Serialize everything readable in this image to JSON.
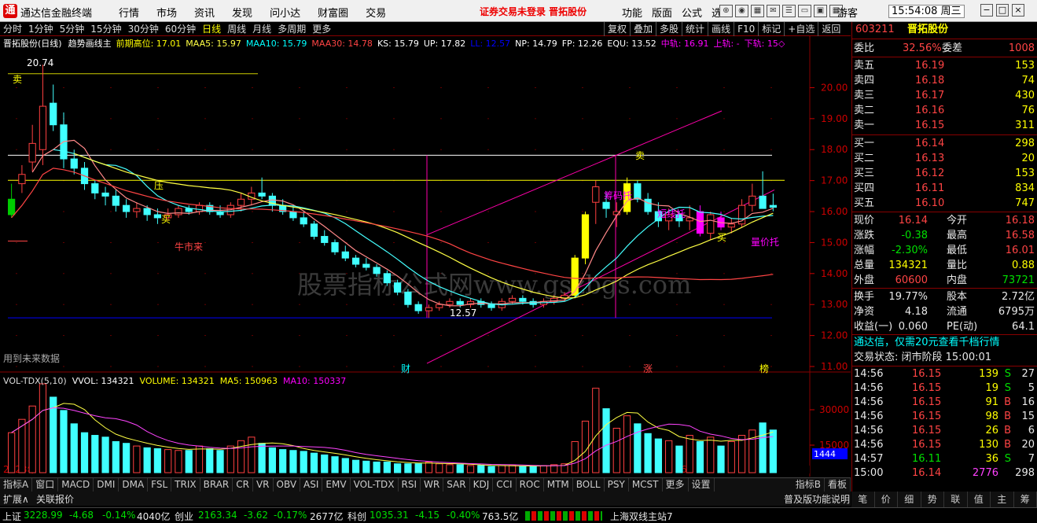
{
  "titlebar": {
    "logo_char": "通",
    "app_name": "通达信金融终端",
    "menus": [
      "行情",
      "市场",
      "资讯",
      "发现",
      "问小达",
      "财富圈",
      "交易"
    ],
    "warning": "证券交易未登录  晋拓股份",
    "right_menus": [
      "功能",
      "版面",
      "公式",
      "选项"
    ],
    "guest": "游客",
    "clock": "15:54:08 周三",
    "win_btns": [
      "−",
      "□",
      "×"
    ]
  },
  "periodbar": {
    "items": [
      "分时",
      "1分钟",
      "5分钟",
      "15分钟",
      "30分钟",
      "60分钟",
      "日线",
      "周线",
      "月线",
      "多周期",
      "更多"
    ],
    "active": "日线"
  },
  "toolbar2": [
    "复权",
    "叠加",
    "多股",
    "统计",
    "画线",
    "F10",
    "标记",
    "+自选",
    "返回"
  ],
  "infoline": {
    "name": "晋拓股份(日线)",
    "indicator": "趋势画线主",
    "items": [
      [
        "前期高位: 17.01",
        "#ff0"
      ],
      [
        "MAA5: 15.97",
        "#ff4"
      ],
      [
        "MAA10: 15.79",
        "#0ff"
      ],
      [
        "MAA30: 14.78",
        "#f44"
      ],
      [
        "KS: 15.79",
        "#fff"
      ],
      [
        "UP: 17.82",
        "#fff"
      ],
      [
        "LL: 12.57",
        "#00f"
      ],
      [
        "NP: 14.79",
        "#fff"
      ],
      [
        "FP: 12.26",
        "#fff"
      ],
      [
        "EQU: 13.52",
        "#fff"
      ],
      [
        "中轨: 16.91",
        "#f0f"
      ],
      [
        "上轨: -",
        "#f0f"
      ],
      [
        "下轨: 15◇",
        "#f0f"
      ]
    ]
  },
  "price_axis": [
    "20.00",
    "19.00",
    "18.00",
    "17.00",
    "16.00",
    "15.00",
    "14.00",
    "13.00",
    "12.00",
    "11.00"
  ],
  "vol_axis": [
    "30000",
    "15000"
  ],
  "chart_labels": {
    "high": "20.74",
    "low": "12.57",
    "sell": "卖",
    "buy": "买",
    "press": "压",
    "bull": "牛市来",
    "future": "用到未来数据",
    "cai": "财",
    "zhang": "涨",
    "bang": "榜",
    "short": "短线托",
    "chip": "筹码托",
    "volprice": "量价托",
    "year": "2023年",
    "m5": "5",
    "m6": "6",
    "watermark": "股票指标公式网www.gszbgs.com",
    "vol_last": "1444"
  },
  "volinfo": {
    "items": [
      [
        "VOL-TDX(5,10)",
        "#ddd"
      ],
      [
        "VVOL: 134321",
        "#fff"
      ],
      [
        "VOLUME: 134321",
        "#ff0"
      ],
      [
        "MA5: 150963",
        "#ff0"
      ],
      [
        "MA10: 150337",
        "#f0f"
      ]
    ]
  },
  "bottombar": [
    "指标A",
    "窗口",
    "MACD",
    "DMI",
    "DMA",
    "FSL",
    "TRIX",
    "BRAR",
    "CR",
    "VR",
    "OBV",
    "ASI",
    "EMV",
    "VOL-TDX",
    "RSI",
    "WR",
    "SAR",
    "KDJ",
    "CCI",
    "ROC",
    "MTM",
    "BOLL",
    "PSY",
    "MCST",
    "更多",
    "设置"
  ],
  "bottombar_right": [
    "指标B",
    "看板"
  ],
  "bottombar2": [
    "扩展∧",
    "关联报价"
  ],
  "bottombar2_right": "普及版功能说明",
  "rp": {
    "code": "603211",
    "name": "晋拓股份",
    "weibi": "委比",
    "weibi_v": "32.56%",
    "weicha": "委差",
    "weicha_v": "1008",
    "asks": [
      [
        "卖五",
        "16.19",
        "153"
      ],
      [
        "卖四",
        "16.18",
        "74"
      ],
      [
        "卖三",
        "16.17",
        "430"
      ],
      [
        "卖二",
        "16.16",
        "76"
      ],
      [
        "卖一",
        "16.15",
        "311"
      ]
    ],
    "bids": [
      [
        "买一",
        "16.14",
        "298"
      ],
      [
        "买二",
        "16.13",
        "20"
      ],
      [
        "买三",
        "16.12",
        "153"
      ],
      [
        "买四",
        "16.11",
        "834"
      ],
      [
        "买五",
        "16.10",
        "747"
      ]
    ],
    "stats": [
      [
        "现价",
        "16.14",
        "今开",
        "16.18"
      ],
      [
        "涨跌",
        "-0.38",
        "最高",
        "16.58"
      ],
      [
        "涨幅",
        "-2.30%",
        "最低",
        "16.01"
      ],
      [
        "总量",
        "134321",
        "量比",
        "0.88"
      ],
      [
        "外盘",
        "60600",
        "内盘",
        "73721"
      ]
    ],
    "stats2": [
      [
        "换手",
        "19.77%",
        "股本",
        "2.72亿"
      ],
      [
        "净资",
        "4.18",
        "流通",
        "6795万"
      ],
      [
        "收益(一)",
        "0.060",
        "PE(动)",
        "64.1"
      ]
    ],
    "promo": "通达信，仅需20元查看千档行情",
    "trade_state": "交易状态: 闭市阶段 15:00:01",
    "ticks": [
      [
        "14:56",
        "16.15",
        "139",
        "S",
        "27"
      ],
      [
        "14:56",
        "16.15",
        "19",
        "S",
        "5"
      ],
      [
        "14:56",
        "16.15",
        "91",
        "B",
        "16"
      ],
      [
        "14:56",
        "16.15",
        "98",
        "B",
        "15"
      ],
      [
        "14:56",
        "16.15",
        "26",
        "B",
        "6"
      ],
      [
        "14:56",
        "16.15",
        "130",
        "B",
        "20"
      ],
      [
        "14:57",
        "16.11",
        "36",
        "S",
        "7"
      ],
      [
        "15:00",
        "16.14",
        "2776",
        "",
        "298"
      ]
    ],
    "tabs": [
      "笔",
      "价",
      "细",
      "势",
      "联",
      "值",
      "主",
      "筹"
    ]
  },
  "right_side_label": "日线",
  "statusbar": {
    "sh": "上证",
    "sh_v": "3228.99",
    "sh_c": "-4.68",
    "sh_p": "-0.14%",
    "sh_a": "4040亿",
    "cy": "创业",
    "cy_v": "2163.34",
    "cy_c": "-3.62",
    "cy_p": "-0.17%",
    "cy_a": "2677亿",
    "kc": "科创",
    "kc_v": "1035.31",
    "kc_c": "-4.15",
    "kc_p": "-0.40%",
    "kc_a": "763.5亿",
    "server": "上海双线主站7"
  },
  "chart_data": {
    "type": "candlestick",
    "ylim": [
      11,
      20.9
    ],
    "candles": [
      [
        15.9,
        16.9,
        15.8,
        16.4
      ],
      [
        16.9,
        17.5,
        16.6,
        17.2
      ],
      [
        17.6,
        18.8,
        17.3,
        18.2
      ],
      [
        18.0,
        20.74,
        17.5,
        19.4
      ],
      [
        19.5,
        20.1,
        18.6,
        18.8
      ],
      [
        18.8,
        19.2,
        17.4,
        17.7
      ],
      [
        17.7,
        18.0,
        17.2,
        17.4
      ],
      [
        17.4,
        17.6,
        16.7,
        16.9
      ],
      [
        16.9,
        17.0,
        16.4,
        16.6
      ],
      [
        16.6,
        16.8,
        16.2,
        16.5
      ],
      [
        16.5,
        16.7,
        16.0,
        16.2
      ],
      [
        16.2,
        16.4,
        15.8,
        16.0
      ],
      [
        16.0,
        16.3,
        15.8,
        16.1
      ],
      [
        16.1,
        16.2,
        15.7,
        15.9
      ],
      [
        15.9,
        16.1,
        15.6,
        15.8
      ],
      [
        15.8,
        16.1,
        15.7,
        15.9
      ],
      [
        15.9,
        16.2,
        15.8,
        16.1
      ],
      [
        16.1,
        16.2,
        15.9,
        16.0
      ],
      [
        16.0,
        16.3,
        15.9,
        16.2
      ],
      [
        16.2,
        16.3,
        15.9,
        16.0
      ],
      [
        16.0,
        16.2,
        15.8,
        15.9
      ],
      [
        15.9,
        16.3,
        15.8,
        16.2
      ],
      [
        16.2,
        16.6,
        16.0,
        16.4
      ],
      [
        16.4,
        16.8,
        16.2,
        16.6
      ],
      [
        16.6,
        17.1,
        16.4,
        16.5
      ],
      [
        16.5,
        16.6,
        16.0,
        16.2
      ],
      [
        16.2,
        16.4,
        15.9,
        16.0
      ],
      [
        16.0,
        16.2,
        15.7,
        15.8
      ],
      [
        15.8,
        16.0,
        15.5,
        15.6
      ],
      [
        15.6,
        15.7,
        15.1,
        15.2
      ],
      [
        15.2,
        15.4,
        14.9,
        15.0
      ],
      [
        15.0,
        15.1,
        14.6,
        14.7
      ],
      [
        14.7,
        14.9,
        14.4,
        14.5
      ],
      [
        14.5,
        14.6,
        14.2,
        14.3
      ],
      [
        14.3,
        14.5,
        14.1,
        14.2
      ],
      [
        14.2,
        14.3,
        13.9,
        14.0
      ],
      [
        14.0,
        14.1,
        13.6,
        13.7
      ],
      [
        13.7,
        13.8,
        13.3,
        13.4
      ],
      [
        13.4,
        13.5,
        12.9,
        13.0
      ],
      [
        13.0,
        13.1,
        12.7,
        12.8
      ],
      [
        12.8,
        13.0,
        12.57,
        12.9
      ],
      [
        12.9,
        13.1,
        12.8,
        13.0
      ],
      [
        13.0,
        13.2,
        12.9,
        13.1
      ],
      [
        13.1,
        13.2,
        12.9,
        13.0
      ],
      [
        13.0,
        13.2,
        12.9,
        13.1
      ],
      [
        13.1,
        13.2,
        12.9,
        13.0
      ],
      [
        13.0,
        13.1,
        12.8,
        12.9
      ],
      [
        12.9,
        13.2,
        12.8,
        13.1
      ],
      [
        13.1,
        13.3,
        13.0,
        13.2
      ],
      [
        13.2,
        13.3,
        13.0,
        13.1
      ],
      [
        13.1,
        13.2,
        12.9,
        13.0
      ],
      [
        13.0,
        13.2,
        12.9,
        13.1
      ],
      [
        13.1,
        13.3,
        13.0,
        13.2
      ],
      [
        13.2,
        13.4,
        13.1,
        13.3
      ],
      [
        13.3,
        14.6,
        13.2,
        14.5
      ],
      [
        14.5,
        16.0,
        14.3,
        15.9
      ],
      [
        16.3,
        17.0,
        15.6,
        16.8
      ],
      [
        16.3,
        16.6,
        15.8,
        16.1
      ],
      [
        15.9,
        16.3,
        15.5,
        16.0
      ],
      [
        16.0,
        17.1,
        15.9,
        16.9
      ],
      [
        16.9,
        17.0,
        16.3,
        16.4
      ],
      [
        16.4,
        16.6,
        15.9,
        16.0
      ],
      [
        16.0,
        16.3,
        15.5,
        15.7
      ],
      [
        15.7,
        16.1,
        15.4,
        15.9
      ],
      [
        15.9,
        16.0,
        15.5,
        15.7
      ],
      [
        15.7,
        16.2,
        15.4,
        15.8
      ],
      [
        16.0,
        16.2,
        15.2,
        15.3
      ],
      [
        15.3,
        16.0,
        15.1,
        15.9
      ],
      [
        15.8,
        16.0,
        15.4,
        15.5
      ],
      [
        15.5,
        15.8,
        15.3,
        15.6
      ],
      [
        15.6,
        16.4,
        15.5,
        16.2
      ],
      [
        16.2,
        16.9,
        16.0,
        16.5
      ],
      [
        16.5,
        17.3,
        16.4,
        16.1
      ],
      [
        16.2,
        16.58,
        16.01,
        16.14
      ]
    ],
    "volumes": [
      0.45,
      0.6,
      0.75,
      1.0,
      0.85,
      0.7,
      0.55,
      0.45,
      0.42,
      0.4,
      0.35,
      0.33,
      0.3,
      0.28,
      0.27,
      0.26,
      0.25,
      0.25,
      0.3,
      0.27,
      0.25,
      0.3,
      0.36,
      0.4,
      0.33,
      0.28,
      0.26,
      0.25,
      0.24,
      0.22,
      0.2,
      0.18,
      0.16,
      0.14,
      0.13,
      0.12,
      0.12,
      0.1,
      0.1,
      0.1,
      0.12,
      0.1,
      0.09,
      0.09,
      0.08,
      0.08,
      0.07,
      0.08,
      0.08,
      0.07,
      0.07,
      0.08,
      0.09,
      0.1,
      0.35,
      0.58,
      0.95,
      0.72,
      0.5,
      0.64,
      0.55,
      0.44,
      0.38,
      0.36,
      0.3,
      0.42,
      0.35,
      0.4,
      0.3,
      0.35,
      0.42,
      0.48,
      0.56,
      0.48
    ]
  }
}
